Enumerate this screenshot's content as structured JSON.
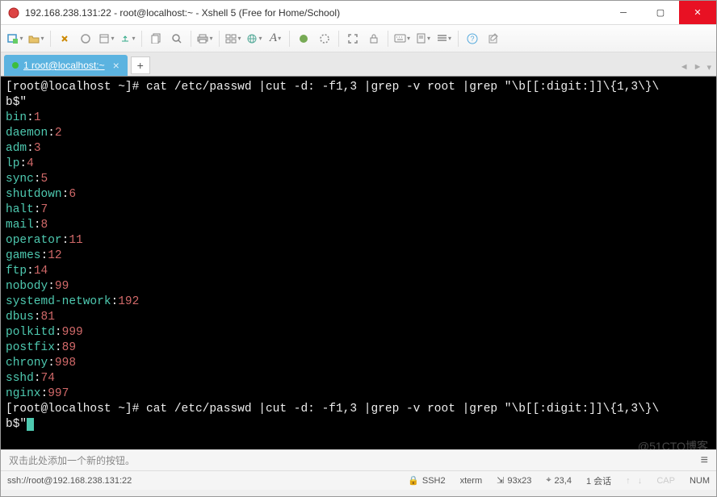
{
  "window": {
    "title": "192.168.238.131:22 - root@localhost:~ - Xshell 5 (Free for Home/School)"
  },
  "tab": {
    "label": "1 root@localhost:~"
  },
  "terminal": {
    "prompt1_a": "[root@localhost ~]# ",
    "prompt1_b": "cat /etc/passwd |cut -d: -f1,3 |grep -v root |grep \"\\b[[:digit:]]\\{1,3\\}\\",
    "prompt1_c": "b$\"",
    "rows": [
      {
        "user": "bin",
        "uid": "1"
      },
      {
        "user": "daemon",
        "uid": "2"
      },
      {
        "user": "adm",
        "uid": "3"
      },
      {
        "user": "lp",
        "uid": "4"
      },
      {
        "user": "sync",
        "uid": "5"
      },
      {
        "user": "shutdown",
        "uid": "6"
      },
      {
        "user": "halt",
        "uid": "7"
      },
      {
        "user": "mail",
        "uid": "8"
      },
      {
        "user": "operator",
        "uid": "11"
      },
      {
        "user": "games",
        "uid": "12"
      },
      {
        "user": "ftp",
        "uid": "14"
      },
      {
        "user": "nobody",
        "uid": "99"
      },
      {
        "user": "systemd-network",
        "uid": "192"
      },
      {
        "user": "dbus",
        "uid": "81"
      },
      {
        "user": "polkitd",
        "uid": "999"
      },
      {
        "user": "postfix",
        "uid": "89"
      },
      {
        "user": "chrony",
        "uid": "998"
      },
      {
        "user": "sshd",
        "uid": "74"
      },
      {
        "user": "nginx",
        "uid": "997"
      }
    ],
    "prompt2_a": "[root@localhost ~]# ",
    "prompt2_b": "cat /etc/passwd |cut -d: -f1,3 |grep -v root |grep \"\\b[[:digit:]]\\{1,3\\}\\",
    "prompt2_c": "b$\""
  },
  "footer": {
    "hint": "双击此处添加一个新的按钮。"
  },
  "status": {
    "conn": "ssh://root@192.168.238.131:22",
    "proto": "SSH2",
    "term": "xterm",
    "size": "93x23",
    "cursor": "23,4",
    "session": "1 会话",
    "caps": "CAP",
    "num": "NUM"
  },
  "watermark": "@51CTO博客"
}
